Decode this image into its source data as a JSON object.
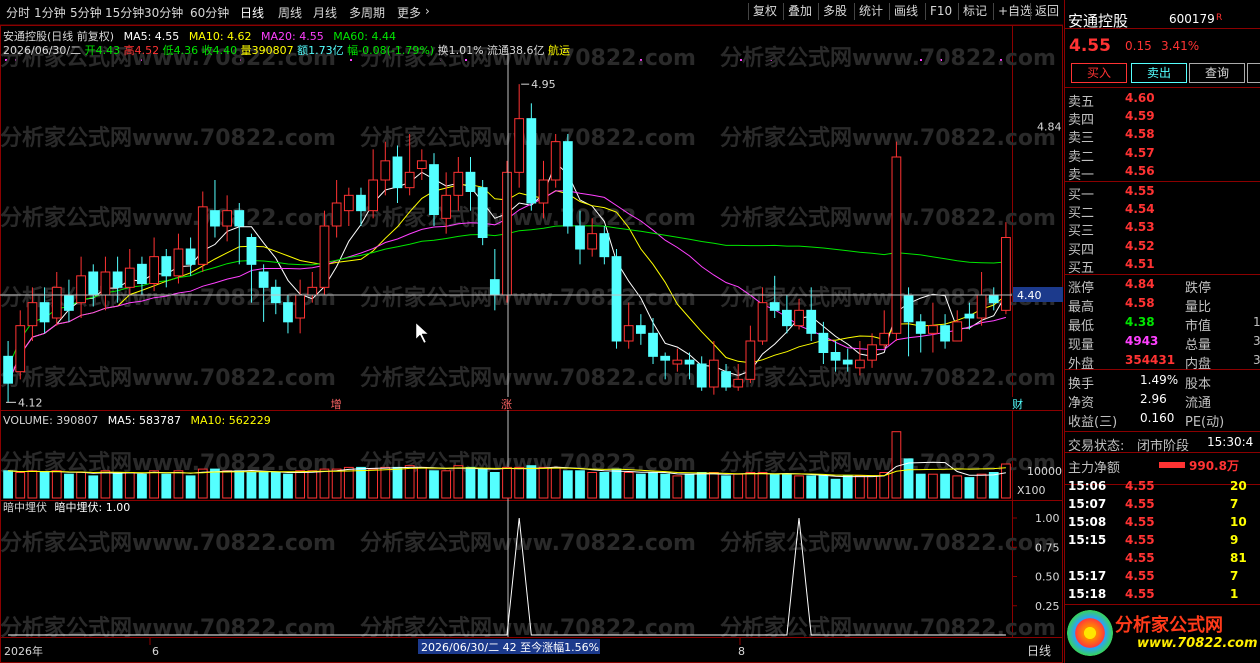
{
  "toolbar": {
    "periods": [
      "分时",
      "1分钟",
      "5分钟",
      "15分钟",
      "30分钟",
      "60分钟",
      "日线",
      "周线",
      "月线",
      "多周期",
      "更多"
    ],
    "active": "日线",
    "more_icon": "chevron-right-icon",
    "right_buttons": [
      "复权",
      "叠加",
      "多股",
      "统计",
      "画线",
      "F10",
      "标记",
      "+自选",
      "返回"
    ]
  },
  "kchart": {
    "title": "安通控股(日线 前复权)",
    "ma_line": {
      "MA5": "MA5: 4.55",
      "MA10": "MA10: 4.62",
      "MA20": "MA20: 4.55",
      "MA60": "MA60: 4.44"
    },
    "ohlc_line": {
      "date": "2026/06/30/二",
      "open": "开4.43",
      "high": "高4.52",
      "low": "低4.36",
      "close": "收4.40",
      "volume": "量390807",
      "amount": "额1.73亿",
      "change": "幅-0.08(-1.79%)",
      "turnover": "换1.01%",
      "float": "流通38.6亿",
      "sector": "航运"
    },
    "max_label": "4.95",
    "min_label": "4.12",
    "axis_top_label": "4.84",
    "cursor_price": "4.40",
    "markers": [
      "增",
      "涨",
      "财"
    ],
    "watermark": "分析家公式网www.70822.com"
  },
  "volume_panel": {
    "label": "VOLUME: 390807",
    "ma5": "MA5: 583787",
    "ma10": "MA10: 562229",
    "axis_label": "10000",
    "unit": "X100"
  },
  "indicator_panel": {
    "name": "暗中埋伏",
    "value": "暗中埋伏: 1.00",
    "ticks": [
      "1.00",
      "0.75",
      "0.50",
      "0.25"
    ]
  },
  "bottom_axis": {
    "year": "2026年",
    "m6": "6",
    "m8": "8",
    "cursor_info": "2026/06/30/二 42 至今涨幅1.56%",
    "period_label": "日线"
  },
  "quote": {
    "name": "安通控股",
    "code": "600179",
    "badge": "R",
    "price": "4.55",
    "change": "0.15",
    "pct": "3.41%",
    "buy_label": "买入",
    "sell_label": "卖出",
    "query_label": "查询",
    "asks": [
      {
        "label": "卖五",
        "price": "4.60"
      },
      {
        "label": "卖四",
        "price": "4.59"
      },
      {
        "label": "卖三",
        "price": "4.58"
      },
      {
        "label": "卖二",
        "price": "4.57"
      },
      {
        "label": "卖一",
        "price": "4.56"
      }
    ],
    "bids": [
      {
        "label": "买一",
        "price": "4.55"
      },
      {
        "label": "买二",
        "price": "4.54"
      },
      {
        "label": "买三",
        "price": "4.53"
      },
      {
        "label": "买四",
        "price": "4.52"
      },
      {
        "label": "买五",
        "price": "4.51"
      }
    ],
    "stats": [
      {
        "l1": "涨停",
        "v1": "4.84",
        "l2": "跌停"
      },
      {
        "l1": "最高",
        "v1": "4.58",
        "l2": "量比"
      },
      {
        "l1": "最低",
        "v1": "4.38",
        "l2": "市值",
        "v2": "1"
      },
      {
        "l1": "现量",
        "v1": "4943",
        "l2": "总量",
        "v2": "3"
      },
      {
        "l1": "外盘",
        "v1": "354431",
        "l2": "内盘",
        "v2": "3"
      }
    ],
    "stats2": [
      {
        "l1": "换手",
        "v1": "1.49%",
        "l2": "股本"
      },
      {
        "l1": "净资",
        "v1": "2.96",
        "l2": "流通"
      },
      {
        "l1": "收益(三)",
        "v1": "0.160",
        "l2": "PE(动)"
      }
    ],
    "status_label": "交易状态:",
    "status_value": "闭市阶段",
    "status_time": "15:30:4",
    "main_net_label": "主力净额",
    "main_net_value": "990.8万",
    "ticks": [
      {
        "t": "15:06",
        "p": "4.55",
        "v": "20"
      },
      {
        "t": "15:07",
        "p": "4.55",
        "v": "7"
      },
      {
        "t": "15:08",
        "p": "4.55",
        "v": "10"
      },
      {
        "t": "15:15",
        "p": "4.55",
        "v": "9"
      },
      {
        "t": "",
        "p": "4.55",
        "v": "81"
      },
      {
        "t": "15:17",
        "p": "4.55",
        "v": "7"
      },
      {
        "t": "15:18",
        "p": "4.55",
        "v": "1"
      }
    ],
    "logo_text": "分析家公式网",
    "logo_url": "www.70822.com"
  },
  "colors": {
    "up": "#ff3333",
    "down": "#54ffff",
    "ma5": "#ffffff",
    "ma10": "#ffff00",
    "ma20": "#ff40ff",
    "ma60": "#00e600",
    "border": "#8b0000"
  },
  "chart_data": {
    "type": "candlestick",
    "candles": [
      [
        4.24,
        4.17,
        4.28,
        4.12
      ],
      [
        4.2,
        4.32,
        4.36,
        4.18
      ],
      [
        4.32,
        4.38,
        4.42,
        4.28
      ],
      [
        4.38,
        4.33,
        4.42,
        4.3
      ],
      [
        4.34,
        4.42,
        4.46,
        4.32
      ],
      [
        4.4,
        4.36,
        4.44,
        4.33
      ],
      [
        4.38,
        4.45,
        4.5,
        4.34
      ],
      [
        4.46,
        4.4,
        4.48,
        4.37
      ],
      [
        4.4,
        4.46,
        4.5,
        4.36
      ],
      [
        4.46,
        4.42,
        4.5,
        4.38
      ],
      [
        4.42,
        4.47,
        4.52,
        4.4
      ],
      [
        4.48,
        4.43,
        4.5,
        4.4
      ],
      [
        4.43,
        4.5,
        4.55,
        4.41
      ],
      [
        4.5,
        4.45,
        4.52,
        4.42
      ],
      [
        4.45,
        4.52,
        4.56,
        4.43
      ],
      [
        4.52,
        4.48,
        4.55,
        4.45
      ],
      [
        4.48,
        4.63,
        4.67,
        4.46
      ],
      [
        4.62,
        4.58,
        4.7,
        4.55
      ],
      [
        4.58,
        4.62,
        4.66,
        4.54
      ],
      [
        4.62,
        4.58,
        4.64,
        4.48
      ],
      [
        4.55,
        4.48,
        4.56,
        4.38
      ],
      [
        4.46,
        4.42,
        4.48,
        4.33
      ],
      [
        4.42,
        4.38,
        4.44,
        4.35
      ],
      [
        4.38,
        4.33,
        4.4,
        4.3
      ],
      [
        4.34,
        4.4,
        4.44,
        4.3
      ],
      [
        4.4,
        4.42,
        4.46,
        4.38
      ],
      [
        4.42,
        4.58,
        4.62,
        4.4
      ],
      [
        4.58,
        4.64,
        4.7,
        4.55
      ],
      [
        4.62,
        4.66,
        4.68,
        4.58
      ],
      [
        4.66,
        4.62,
        4.68,
        4.58
      ],
      [
        4.62,
        4.7,
        4.78,
        4.6
      ],
      [
        4.7,
        4.75,
        4.8,
        4.66
      ],
      [
        4.76,
        4.68,
        4.79,
        4.64
      ],
      [
        4.68,
        4.72,
        4.82,
        4.66
      ],
      [
        4.73,
        4.75,
        4.78,
        4.7
      ],
      [
        4.74,
        4.61,
        4.77,
        4.58
      ],
      [
        4.6,
        4.66,
        4.72,
        4.56
      ],
      [
        4.66,
        4.72,
        4.76,
        4.62
      ],
      [
        4.72,
        4.67,
        4.76,
        4.62
      ],
      [
        4.68,
        4.55,
        4.7,
        4.53
      ],
      [
        4.44,
        4.4,
        4.52,
        4.36
      ],
      [
        4.4,
        4.72,
        4.75,
        4.38
      ],
      [
        4.72,
        4.86,
        4.95,
        4.68
      ],
      [
        4.86,
        4.64,
        4.9,
        4.62
      ],
      [
        4.64,
        4.7,
        4.75,
        4.6
      ],
      [
        4.7,
        4.8,
        4.82,
        4.68
      ],
      [
        4.8,
        4.58,
        4.82,
        4.56
      ],
      [
        4.58,
        4.52,
        4.62,
        4.48
      ],
      [
        4.52,
        4.56,
        4.6,
        4.5
      ],
      [
        4.56,
        4.5,
        4.58,
        4.48
      ],
      [
        4.5,
        4.28,
        4.52,
        4.26
      ],
      [
        4.28,
        4.32,
        4.38,
        4.26
      ],
      [
        4.32,
        4.3,
        4.35,
        4.27
      ],
      [
        4.3,
        4.24,
        4.34,
        4.22
      ],
      [
        4.24,
        4.23,
        4.25,
        4.18
      ],
      [
        4.22,
        4.23,
        4.26,
        4.2
      ],
      [
        4.23,
        4.22,
        4.25,
        4.18
      ],
      [
        4.22,
        4.16,
        4.24,
        4.15
      ],
      [
        4.16,
        4.23,
        4.28,
        4.14
      ],
      [
        4.2,
        4.16,
        4.22,
        4.15
      ],
      [
        4.16,
        4.18,
        4.22,
        4.15
      ],
      [
        4.18,
        4.28,
        4.32,
        4.17
      ],
      [
        4.28,
        4.38,
        4.42,
        4.27
      ],
      [
        4.38,
        4.36,
        4.45,
        4.34
      ],
      [
        4.36,
        4.32,
        4.4,
        4.3
      ],
      [
        4.32,
        4.36,
        4.39,
        4.31
      ],
      [
        4.36,
        4.3,
        4.42,
        4.28
      ],
      [
        4.3,
        4.25,
        4.33,
        4.22
      ],
      [
        4.25,
        4.23,
        4.28,
        4.2
      ],
      [
        4.23,
        4.22,
        4.26,
        4.2
      ],
      [
        4.21,
        4.23,
        4.28,
        4.19
      ],
      [
        4.23,
        4.27,
        4.3,
        4.21
      ],
      [
        4.27,
        4.3,
        4.36,
        4.26
      ],
      [
        4.3,
        4.76,
        4.8,
        4.28
      ],
      [
        4.4,
        4.33,
        4.42,
        4.24
      ],
      [
        4.33,
        4.3,
        4.35,
        4.25
      ],
      [
        4.3,
        4.32,
        4.38,
        4.25
      ],
      [
        4.32,
        4.28,
        4.35,
        4.26
      ],
      [
        4.28,
        4.33,
        4.36,
        4.28
      ],
      [
        4.35,
        4.34,
        4.38,
        4.31
      ],
      [
        4.34,
        4.4,
        4.46,
        4.32
      ],
      [
        4.4,
        4.38,
        4.42,
        4.36
      ],
      [
        4.36,
        4.55,
        4.59,
        4.35
      ]
    ],
    "volume": [
      1.6,
      1.5,
      1.6,
      1.5,
      1.6,
      1.4,
      1.5,
      1.3,
      1.6,
      1.5,
      1.5,
      1.4,
      1.6,
      1.4,
      1.6,
      1.3,
      1.7,
      1.7,
      1.6,
      1.6,
      1.5,
      1.5,
      1.5,
      1.4,
      1.6,
      1.6,
      1.7,
      1.7,
      1.8,
      1.8,
      1.7,
      1.8,
      1.8,
      1.9,
      1.8,
      1.6,
      1.6,
      1.9,
      1.8,
      1.7,
      1.5,
      1.8,
      1.8,
      1.9,
      1.8,
      1.8,
      1.6,
      1.6,
      1.5,
      1.5,
      1.7,
      1.5,
      1.4,
      1.5,
      1.4,
      1.3,
      1.4,
      1.5,
      1.5,
      1.3,
      1.4,
      1.5,
      1.5,
      1.4,
      1.4,
      1.3,
      1.3,
      1.3,
      1.1,
      1.3,
      1.3,
      1.3,
      1.5,
      3.9,
      2.3,
      1.4,
      1.4,
      1.4,
      1.3,
      1.2,
      1.4,
      1.5,
      2.0
    ],
    "indicator": {
      "peaks_at": [
        42,
        65
      ],
      "values_at_peaks": 1.0,
      "ticks": [
        0.25,
        0.5,
        0.75,
        1.0
      ]
    },
    "price_range": [
      4.1,
      5.0
    ]
  }
}
